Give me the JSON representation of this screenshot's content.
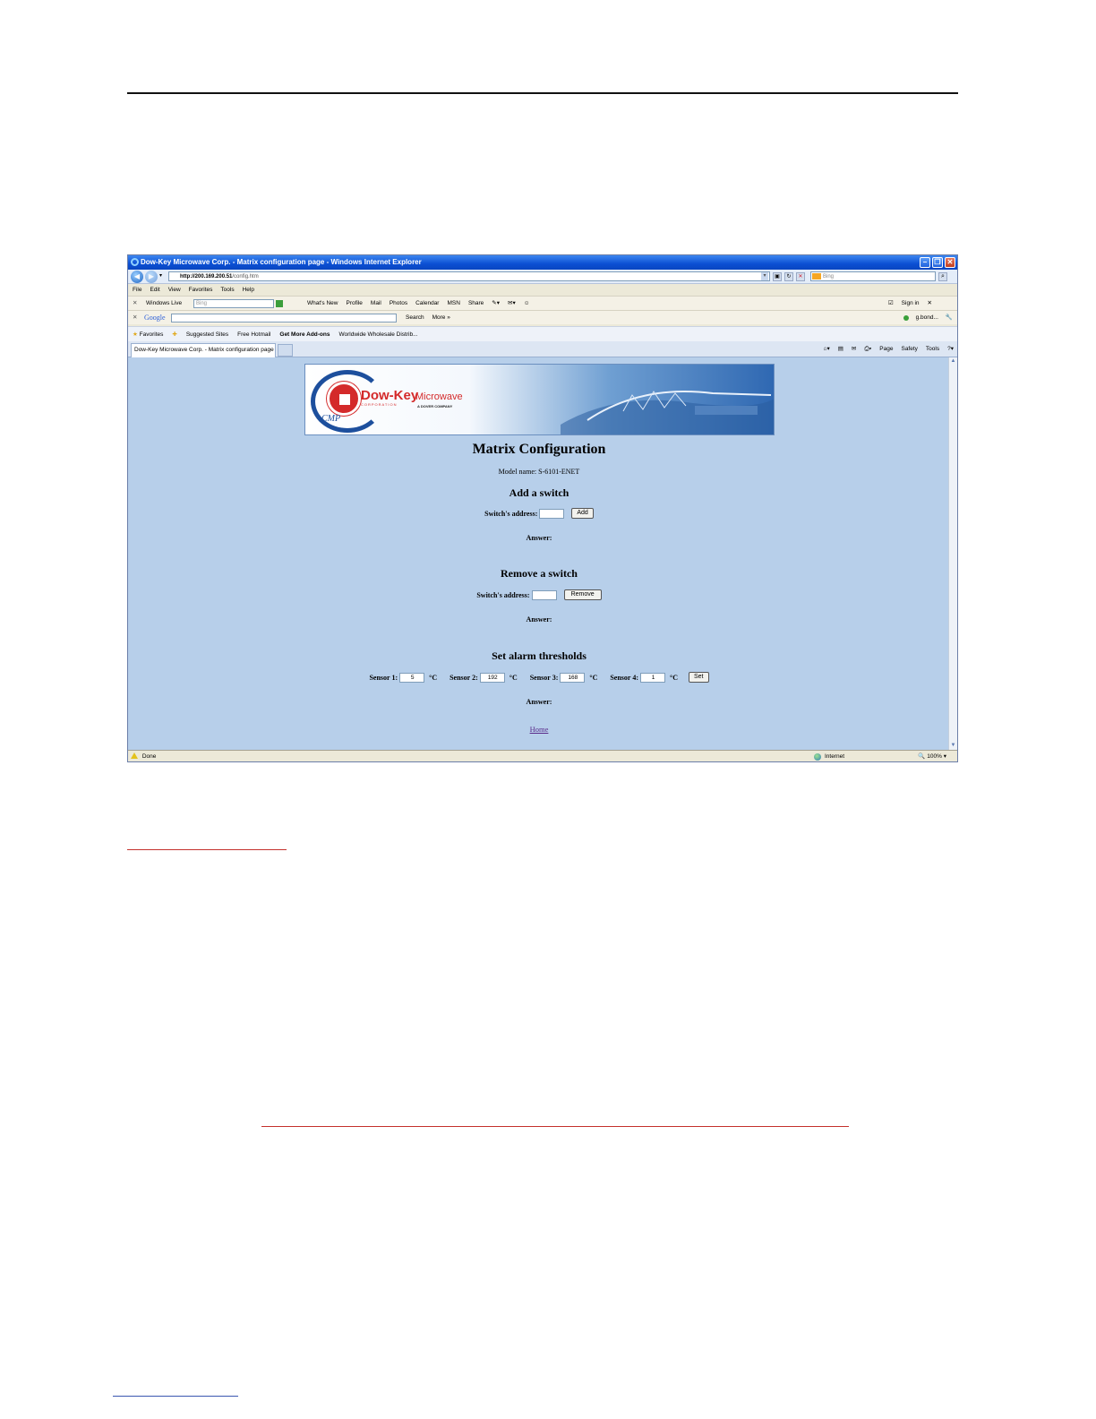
{
  "browser": {
    "title": "Dow-Key Microwave Corp. - Matrix configuration page - Windows Internet Explorer",
    "url_host": "http://200.169.200.51",
    "url_path": "/config.htm",
    "search_placeholder": "Bing",
    "menu": [
      "File",
      "Edit",
      "View",
      "Favorites",
      "Tools",
      "Help"
    ],
    "windows_live": {
      "label": "Windows Live",
      "search_placeholder": "Bing",
      "links": [
        "What's New",
        "Profile",
        "Mail",
        "Photos",
        "Calendar",
        "MSN",
        "Share"
      ],
      "sign_in": "Sign in"
    },
    "google_bar": {
      "logo": "Google",
      "search": "Search",
      "more": "More »",
      "account": "g.bond..."
    },
    "favorites": {
      "label": "Favorites",
      "items": [
        "Suggested Sites",
        "Free Hotmail",
        "Get More Add-ons",
        "Worldwide Wholesale Distrib..."
      ]
    },
    "tab_title": "Dow-Key Microwave Corp. - Matrix configuration page",
    "commands": [
      "Page",
      "Safety",
      "Tools"
    ],
    "status": {
      "left": "Done",
      "zone": "Internet",
      "zoom": "100%"
    }
  },
  "banner": {
    "brand": "Dow-Key",
    "brand_sub": "Microwave",
    "corporation": "CORPORATION",
    "dover": "A DOVER COMPANY",
    "cmp": "CMP"
  },
  "page": {
    "title": "Matrix Configuration",
    "model": "Model name: S-6101-ENET",
    "add": {
      "heading": "Add a switch",
      "label": "Switch's address:",
      "value": "",
      "button": "Add",
      "answer": "Answer:"
    },
    "remove": {
      "heading": "Remove a switch",
      "label": "Switch's address:",
      "value": "",
      "button": "Remove",
      "answer": "Answer:"
    },
    "alarm": {
      "heading": "Set alarm thresholds",
      "sensors": [
        {
          "label": "Sensor 1:",
          "value": "5",
          "unit": "°C"
        },
        {
          "label": "Sensor 2:",
          "value": "192",
          "unit": "°C"
        },
        {
          "label": "Sensor 3:",
          "value": "168",
          "unit": "°C"
        },
        {
          "label": "Sensor 4:",
          "value": "1",
          "unit": "°C"
        }
      ],
      "button": "Set",
      "answer": "Answer:"
    },
    "home_link": "Home"
  },
  "colors": {
    "page_background": "#b7cfea",
    "titlebar": "#0b4fd3",
    "brand_red": "#d42a2a"
  }
}
